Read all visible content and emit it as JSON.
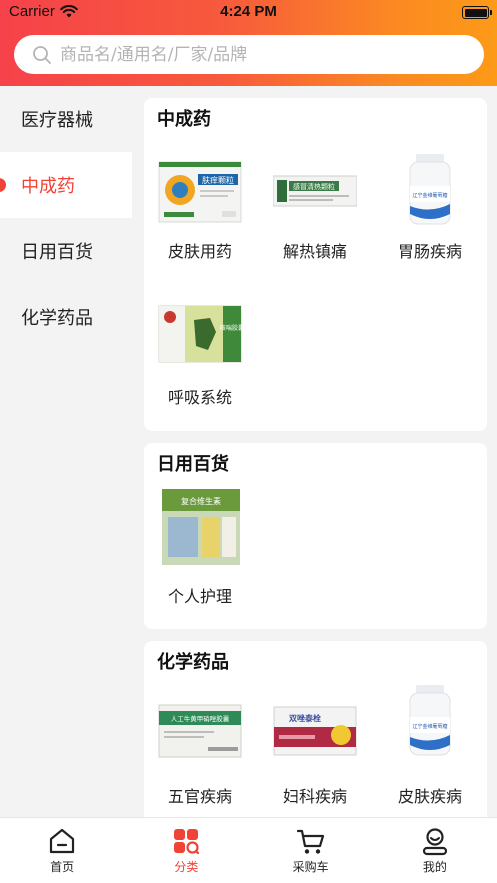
{
  "status_bar": {
    "carrier": "Carrier",
    "time": "4:24 PM"
  },
  "search": {
    "placeholder": "商品名/通用名/厂家/品牌"
  },
  "sidebar": {
    "items": [
      {
        "label": "医疗器械",
        "active": false
      },
      {
        "label": "中成药",
        "active": true
      },
      {
        "label": "日用百货",
        "active": false
      },
      {
        "label": "化学药品",
        "active": false
      }
    ]
  },
  "sections": [
    {
      "title": "中成药",
      "products": [
        {
          "label": "皮肤用药",
          "box_text": "肤痒颗粒"
        },
        {
          "label": "解热镇痛",
          "box_text": "感冒清热颗粒"
        },
        {
          "label": "胃肠疾病",
          "box_text": "辽宁金维葡萄糖"
        },
        {
          "label": "呼吸系统",
          "box_text": "咳喘胶囊"
        }
      ]
    },
    {
      "title": "日用百货",
      "products": [
        {
          "label": "个人护理",
          "box_text": "复合维生素"
        }
      ]
    },
    {
      "title": "化学药品",
      "products": [
        {
          "label": "五官疾病",
          "box_text": "人工牛黄甲硝唑胶囊"
        },
        {
          "label": "妇科疾病",
          "box_text": "双唑泰栓"
        },
        {
          "label": "皮肤疾病",
          "box_text": "辽宁金维葡萄糖"
        }
      ]
    }
  ],
  "tabbar": {
    "items": [
      {
        "label": "首页",
        "icon": "home-icon"
      },
      {
        "label": "分类",
        "icon": "category-icon",
        "active": true
      },
      {
        "label": "采购车",
        "icon": "cart-icon"
      },
      {
        "label": "我的",
        "icon": "profile-icon"
      }
    ]
  },
  "colors": {
    "accent": "#f04236",
    "header_start": "#f6424a",
    "header_end": "#fd9a18"
  }
}
